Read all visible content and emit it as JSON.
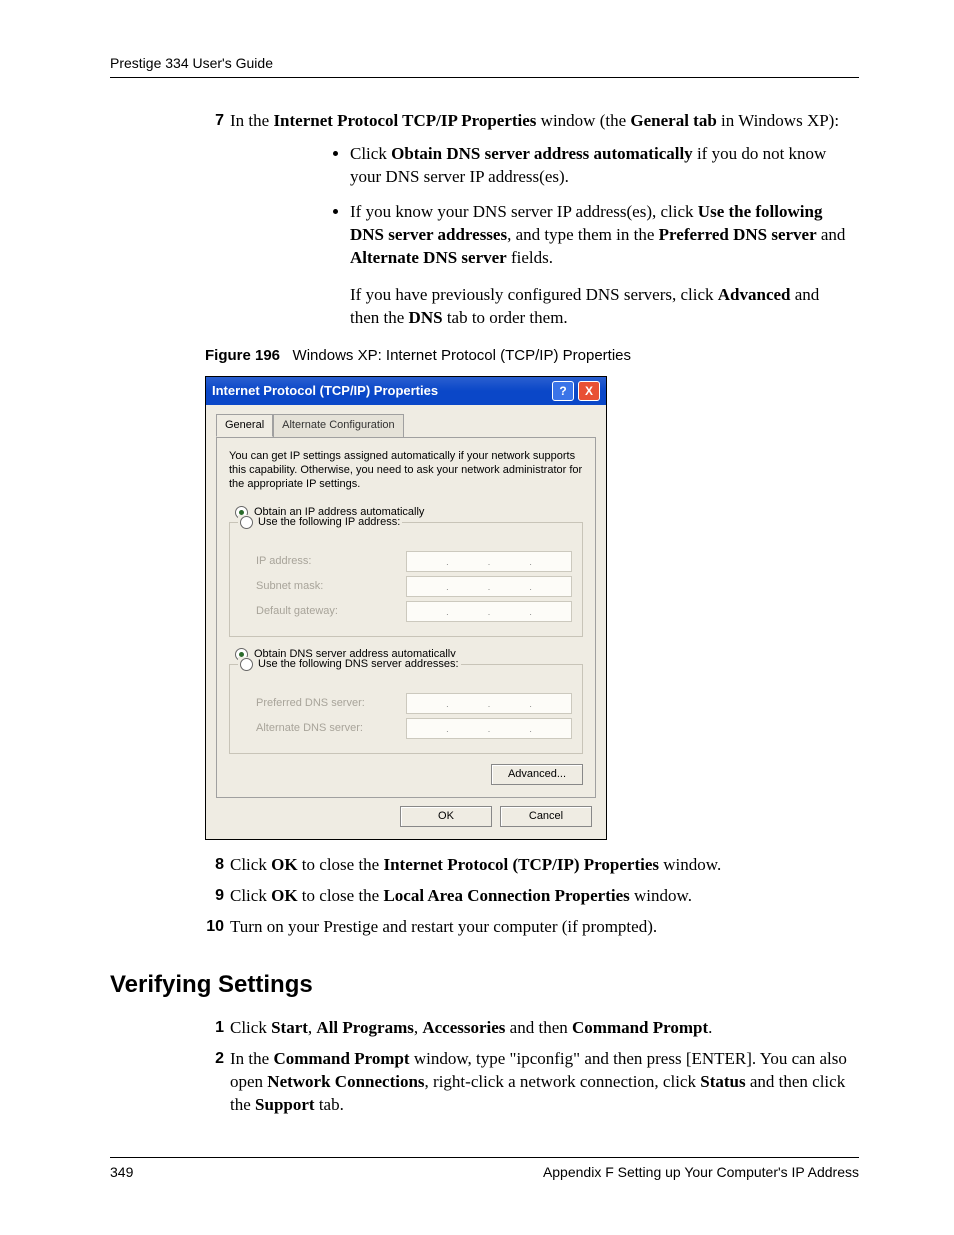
{
  "header": {
    "title": "Prestige 334 User's Guide"
  },
  "step7": {
    "num": "7",
    "pre": "In the ",
    "bold1": "Internet Protocol TCP/IP Properties",
    "mid1": " window (the ",
    "bold2": "General tab",
    "post1": " in Windows XP):",
    "b1_pre": "Click ",
    "b1_bold": "Obtain DNS server address automatically",
    "b1_post": " if you do not know your DNS server IP address(es).",
    "b2_pre": "If you know your DNS server IP address(es), click ",
    "b2_bold1": "Use the following DNS server addresses",
    "b2_mid1": ", and type them in the ",
    "b2_bold2": "Preferred DNS server",
    "b2_mid2": " and ",
    "b2_bold3": "Alternate DNS server",
    "b2_post": " fields.",
    "note_pre": "If you have previously configured DNS servers, click ",
    "note_bold1": "Advanced",
    "note_mid": " and then the ",
    "note_bold2": "DNS",
    "note_post": " tab to order them."
  },
  "figure": {
    "label": "Figure 196",
    "caption": "Windows XP: Internet Protocol (TCP/IP) Properties"
  },
  "dialog": {
    "title": "Internet Protocol (TCP/IP) Properties",
    "tab_general": "General",
    "tab_alt": "Alternate Configuration",
    "intro": "You can get IP settings assigned automatically if your network supports this capability. Otherwise, you need to ask your network administrator for the appropriate IP settings.",
    "radio_ip_auto": "Obtain an IP address automatically",
    "radio_ip_manual": "Use the following IP address:",
    "ip_address": "IP address:",
    "subnet": "Subnet mask:",
    "gateway": "Default gateway:",
    "radio_dns_auto": "Obtain DNS server address automatically",
    "radio_dns_manual": "Use the following DNS server addresses:",
    "pref_dns": "Preferred DNS server:",
    "alt_dns": "Alternate DNS server:",
    "advanced": "Advanced...",
    "ok": "OK",
    "cancel": "Cancel"
  },
  "step8": {
    "num": "8",
    "pre": "Click ",
    "bold1": "OK",
    "mid": " to close the ",
    "bold2": "Internet Protocol (TCP/IP) Properties",
    "post": " window."
  },
  "step9": {
    "num": "9",
    "pre": "Click ",
    "bold1": "OK",
    "mid": " to close the ",
    "bold2": "Local Area Connection Properties",
    "post": " window."
  },
  "step10": {
    "num": "10",
    "text": "Turn on your Prestige and restart your computer (if prompted)."
  },
  "section_heading": "Verifying Settings",
  "vstep1": {
    "num": "1",
    "pre": "Click ",
    "b1": "Start",
    "s1": ", ",
    "b2": "All Programs",
    "s2": ", ",
    "b3": "Accessories",
    "s3": " and then ",
    "b4": "Command Prompt",
    "s4": "."
  },
  "vstep2": {
    "num": "2",
    "pre": "In the ",
    "b1": "Command Prompt",
    "mid1": " window, type \"ipconfig\" and then press [ENTER]. You can also open ",
    "b2": "Network Connections",
    "mid2": ", right-click a network connection, click ",
    "b3": "Status",
    "mid3": " and then click the ",
    "b4": "Support",
    "post": " tab."
  },
  "footer": {
    "page": "349",
    "right": "Appendix F Setting up Your Computer's IP Address"
  }
}
